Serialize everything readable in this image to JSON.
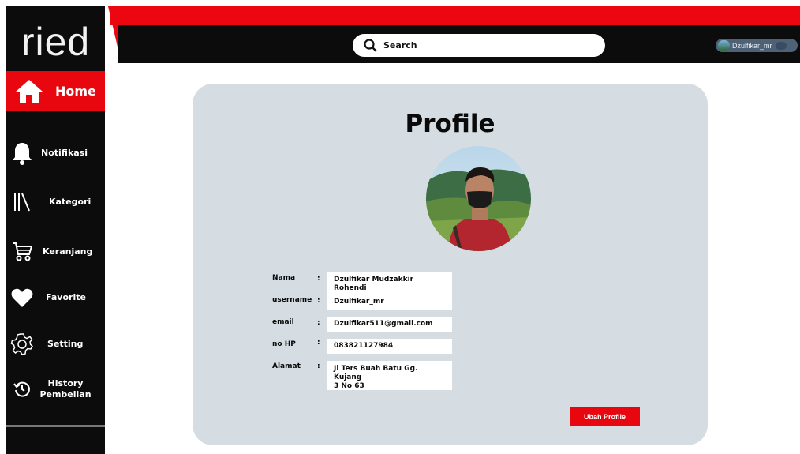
{
  "brand": {
    "logo_text": "ried"
  },
  "sidebar": {
    "home_label": "Home",
    "items": [
      {
        "label": "Notifikasi",
        "icon": "bell-icon"
      },
      {
        "label": "Kategori",
        "icon": "library-icon"
      },
      {
        "label": "Keranjang",
        "icon": "cart-icon"
      },
      {
        "label": "Favorite",
        "icon": "heart-icon"
      },
      {
        "label": "Setting",
        "icon": "gear-icon"
      },
      {
        "label_line1": "History",
        "label_line2": "Pembelian",
        "icon": "history-icon"
      }
    ]
  },
  "header": {
    "search_label": "Search",
    "username": "Dzulfikar_mr"
  },
  "profile": {
    "title": "Profile",
    "fields": [
      {
        "label": "Nama",
        "value": "Dzulfikar Mudzakkir Rohendi"
      },
      {
        "label": "username",
        "value": "Dzulfikar_mr"
      },
      {
        "label": "email",
        "value": "Dzulfikar511@gmail.com"
      },
      {
        "label": "no HP",
        "value": "083821127984"
      },
      {
        "label": "Alamat",
        "value_line1": "Jl Ters Buah Batu Gg. Kujang",
        "value_line2": "3 No 63"
      }
    ],
    "colon": ":",
    "edit_button_label": "Ubah Profile"
  },
  "colors": {
    "accent": "#e8060f",
    "sidebar_bg": "#0c0c0c",
    "card_bg": "#d5dde2"
  }
}
